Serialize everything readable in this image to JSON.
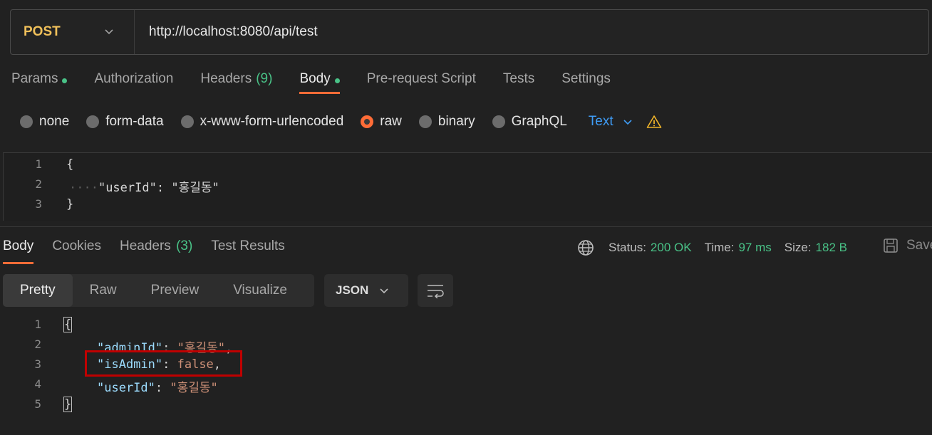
{
  "request": {
    "method": "POST",
    "url": "http://localhost:8080/api/test",
    "tabs": [
      {
        "label": "Params",
        "dot": true
      },
      {
        "label": "Authorization"
      },
      {
        "label": "Headers",
        "count": "(9)"
      },
      {
        "label": "Body",
        "dot": true,
        "active": true
      },
      {
        "label": "Pre-request Script"
      },
      {
        "label": "Tests"
      },
      {
        "label": "Settings"
      }
    ],
    "body_types": [
      "none",
      "form-data",
      "x-www-form-urlencoded",
      "raw",
      "binary",
      "GraphQL"
    ],
    "selected_body_type": "raw",
    "format": "Text",
    "code_lines": [
      "1",
      "2",
      "3"
    ],
    "code": {
      "open": "{",
      "indent": "····",
      "key": "\"userId\"",
      "sep": ": ",
      "value": "\"홍길동\"",
      "close": "}"
    }
  },
  "response": {
    "tabs": [
      {
        "label": "Body",
        "active": true
      },
      {
        "label": "Cookies"
      },
      {
        "label": "Headers",
        "count": "(3)"
      },
      {
        "label": "Test Results"
      }
    ],
    "status_label": "Status:",
    "status_value": "200 OK",
    "time_label": "Time:",
    "time_value": "97 ms",
    "size_label": "Size:",
    "size_value": "182 B",
    "save_label": "Save",
    "view_modes": [
      "Pretty",
      "Raw",
      "Preview",
      "Visualize"
    ],
    "active_view": "Pretty",
    "format": "JSON",
    "code_lines": [
      "1",
      "2",
      "3",
      "4",
      "5"
    ],
    "code": {
      "open": "{",
      "admin_key": "\"adminId\"",
      "admin_val": "\"홍길동\"",
      "isadmin_key": "\"isAdmin\"",
      "isadmin_val": "false",
      "user_key": "\"userId\"",
      "user_val": "\"홍길동\"",
      "close": "}"
    }
  },
  "colors": {
    "accent": "#ff6c37",
    "success": "#49c287",
    "link": "#3f9cf5",
    "method": "#f0c05a",
    "highlight": "#c00000"
  }
}
